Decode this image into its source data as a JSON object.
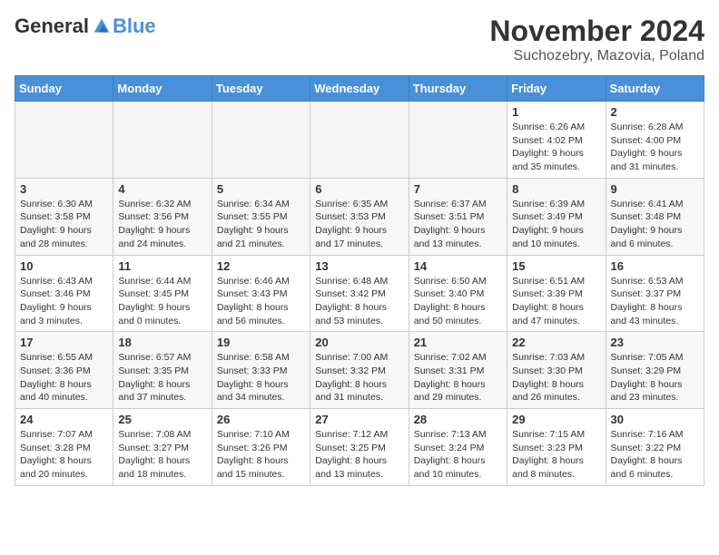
{
  "header": {
    "logo_general": "General",
    "logo_blue": "Blue",
    "title": "November 2024",
    "subtitle": "Suchozebry, Mazovia, Poland"
  },
  "days_of_week": [
    "Sunday",
    "Monday",
    "Tuesday",
    "Wednesday",
    "Thursday",
    "Friday",
    "Saturday"
  ],
  "weeks": [
    [
      {
        "day": "",
        "empty": true
      },
      {
        "day": "",
        "empty": true
      },
      {
        "day": "",
        "empty": true
      },
      {
        "day": "",
        "empty": true
      },
      {
        "day": "",
        "empty": true
      },
      {
        "day": "1",
        "sunrise": "6:26 AM",
        "sunset": "4:02 PM",
        "daylight": "9 hours and 35 minutes."
      },
      {
        "day": "2",
        "sunrise": "6:28 AM",
        "sunset": "4:00 PM",
        "daylight": "9 hours and 31 minutes."
      }
    ],
    [
      {
        "day": "3",
        "sunrise": "6:30 AM",
        "sunset": "3:58 PM",
        "daylight": "9 hours and 28 minutes."
      },
      {
        "day": "4",
        "sunrise": "6:32 AM",
        "sunset": "3:56 PM",
        "daylight": "9 hours and 24 minutes."
      },
      {
        "day": "5",
        "sunrise": "6:34 AM",
        "sunset": "3:55 PM",
        "daylight": "9 hours and 21 minutes."
      },
      {
        "day": "6",
        "sunrise": "6:35 AM",
        "sunset": "3:53 PM",
        "daylight": "9 hours and 17 minutes."
      },
      {
        "day": "7",
        "sunrise": "6:37 AM",
        "sunset": "3:51 PM",
        "daylight": "9 hours and 13 minutes."
      },
      {
        "day": "8",
        "sunrise": "6:39 AM",
        "sunset": "3:49 PM",
        "daylight": "9 hours and 10 minutes."
      },
      {
        "day": "9",
        "sunrise": "6:41 AM",
        "sunset": "3:48 PM",
        "daylight": "9 hours and 6 minutes."
      }
    ],
    [
      {
        "day": "10",
        "sunrise": "6:43 AM",
        "sunset": "3:46 PM",
        "daylight": "9 hours and 3 minutes."
      },
      {
        "day": "11",
        "sunrise": "6:44 AM",
        "sunset": "3:45 PM",
        "daylight": "9 hours and 0 minutes."
      },
      {
        "day": "12",
        "sunrise": "6:46 AM",
        "sunset": "3:43 PM",
        "daylight": "8 hours and 56 minutes."
      },
      {
        "day": "13",
        "sunrise": "6:48 AM",
        "sunset": "3:42 PM",
        "daylight": "8 hours and 53 minutes."
      },
      {
        "day": "14",
        "sunrise": "6:50 AM",
        "sunset": "3:40 PM",
        "daylight": "8 hours and 50 minutes."
      },
      {
        "day": "15",
        "sunrise": "6:51 AM",
        "sunset": "3:39 PM",
        "daylight": "8 hours and 47 minutes."
      },
      {
        "day": "16",
        "sunrise": "6:53 AM",
        "sunset": "3:37 PM",
        "daylight": "8 hours and 43 minutes."
      }
    ],
    [
      {
        "day": "17",
        "sunrise": "6:55 AM",
        "sunset": "3:36 PM",
        "daylight": "8 hours and 40 minutes."
      },
      {
        "day": "18",
        "sunrise": "6:57 AM",
        "sunset": "3:35 PM",
        "daylight": "8 hours and 37 minutes."
      },
      {
        "day": "19",
        "sunrise": "6:58 AM",
        "sunset": "3:33 PM",
        "daylight": "8 hours and 34 minutes."
      },
      {
        "day": "20",
        "sunrise": "7:00 AM",
        "sunset": "3:32 PM",
        "daylight": "8 hours and 31 minutes."
      },
      {
        "day": "21",
        "sunrise": "7:02 AM",
        "sunset": "3:31 PM",
        "daylight": "8 hours and 29 minutes."
      },
      {
        "day": "22",
        "sunrise": "7:03 AM",
        "sunset": "3:30 PM",
        "daylight": "8 hours and 26 minutes."
      },
      {
        "day": "23",
        "sunrise": "7:05 AM",
        "sunset": "3:29 PM",
        "daylight": "8 hours and 23 minutes."
      }
    ],
    [
      {
        "day": "24",
        "sunrise": "7:07 AM",
        "sunset": "3:28 PM",
        "daylight": "8 hours and 20 minutes."
      },
      {
        "day": "25",
        "sunrise": "7:08 AM",
        "sunset": "3:27 PM",
        "daylight": "8 hours and 18 minutes."
      },
      {
        "day": "26",
        "sunrise": "7:10 AM",
        "sunset": "3:26 PM",
        "daylight": "8 hours and 15 minutes."
      },
      {
        "day": "27",
        "sunrise": "7:12 AM",
        "sunset": "3:25 PM",
        "daylight": "8 hours and 13 minutes."
      },
      {
        "day": "28",
        "sunrise": "7:13 AM",
        "sunset": "3:24 PM",
        "daylight": "8 hours and 10 minutes."
      },
      {
        "day": "29",
        "sunrise": "7:15 AM",
        "sunset": "3:23 PM",
        "daylight": "8 hours and 8 minutes."
      },
      {
        "day": "30",
        "sunrise": "7:16 AM",
        "sunset": "3:22 PM",
        "daylight": "8 hours and 6 minutes."
      }
    ]
  ]
}
